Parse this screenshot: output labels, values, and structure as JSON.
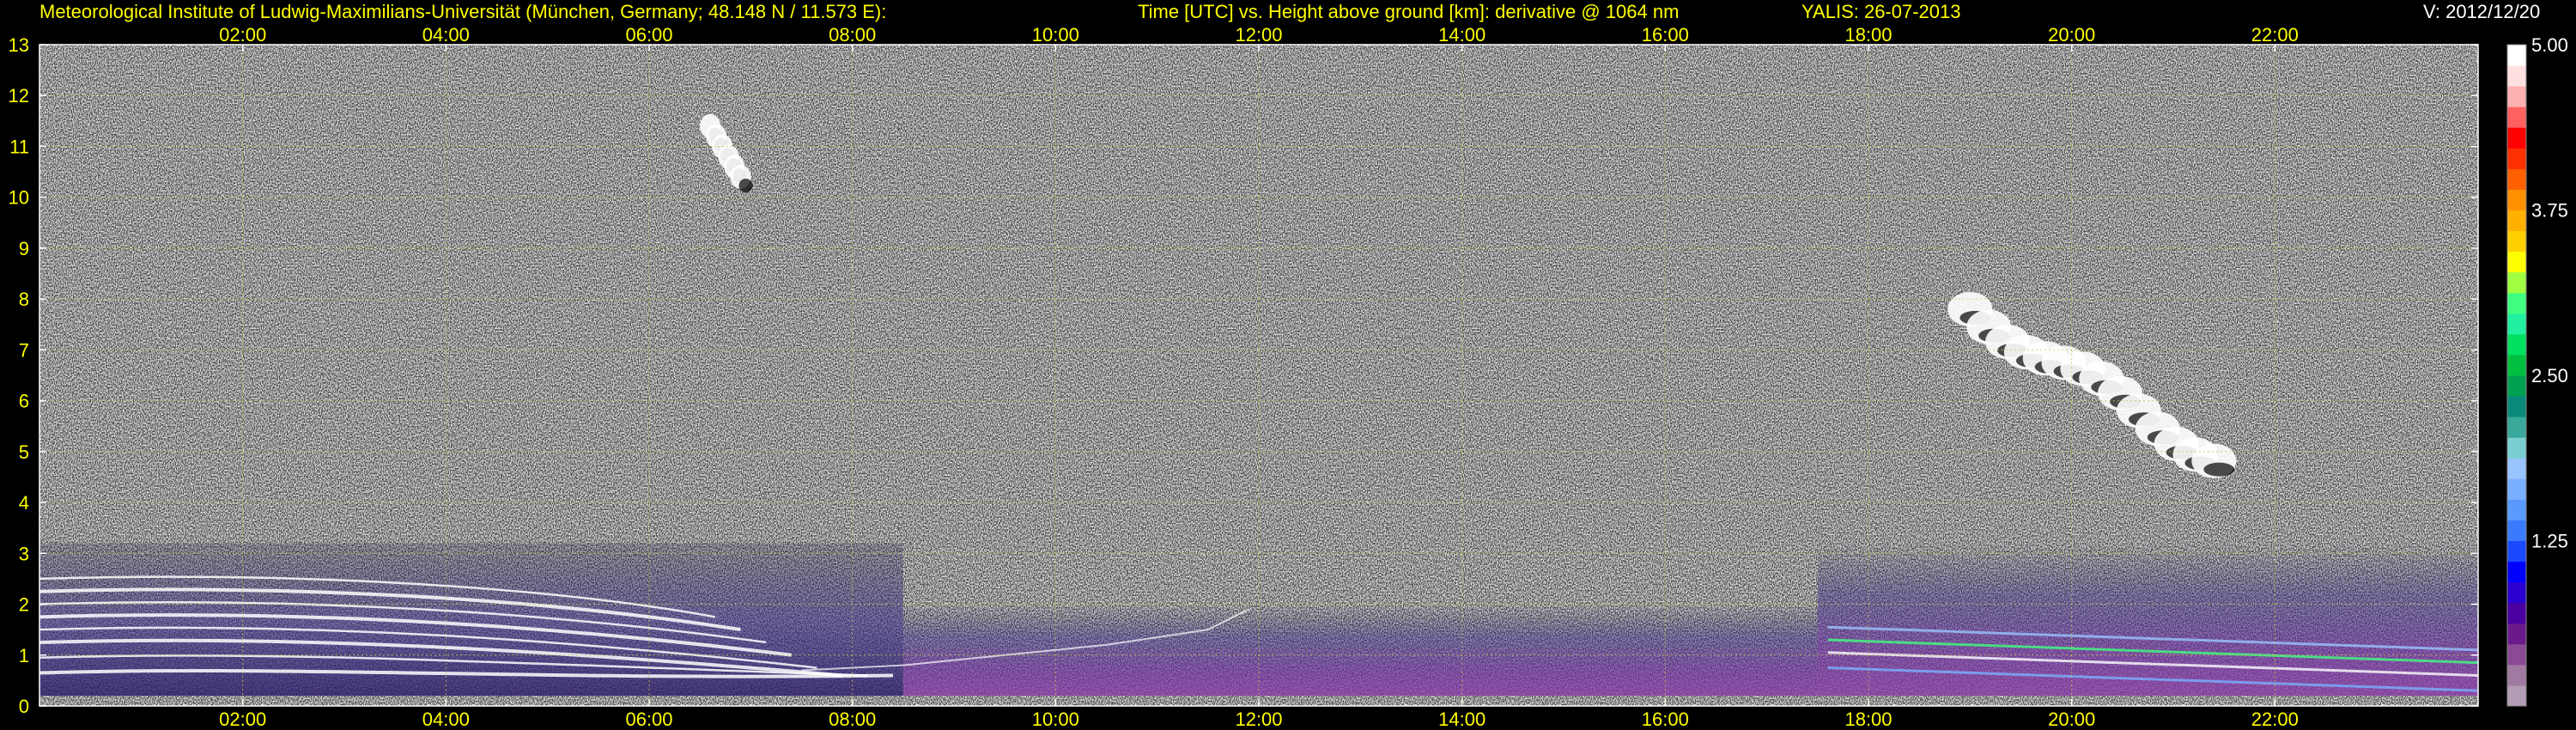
{
  "header": {
    "institute": "Meteorological Institute of Ludwig-Maximilians-Universität (München, Germany; 48.148 N / 11.573 E):",
    "description": "Time [UTC] vs. Height above ground [km]: derivative @ 1064 nm",
    "instrument_date": "YALIS: 26-07-2013",
    "version": "V: 2012/12/20"
  },
  "colors": {
    "background": "#000000",
    "text": "#ffff00",
    "grid": "#c8c84a",
    "frame": "#ffffff"
  },
  "chart_data": {
    "type": "heatmap",
    "title": "Time [UTC] vs. Height above ground [km]: derivative @ 1064 nm",
    "xlabel": "",
    "ylabel": "",
    "x_tick_labels": [
      "02:00",
      "04:00",
      "06:00",
      "08:00",
      "10:00",
      "12:00",
      "14:00",
      "16:00",
      "18:00",
      "20:00",
      "22:00"
    ],
    "x_ticks_hours": [
      2,
      4,
      6,
      8,
      10,
      12,
      14,
      16,
      18,
      20,
      22
    ],
    "xlim_hours": [
      0,
      24
    ],
    "y_ticks": [
      0,
      1,
      2,
      3,
      4,
      5,
      6,
      7,
      8,
      9,
      10,
      11,
      12,
      13
    ],
    "ylim_km": [
      0,
      13
    ],
    "grid": true,
    "colorbar": {
      "labels": [
        "5.00",
        "3.75",
        "2.50",
        "1.25"
      ],
      "label_values": [
        5.0,
        3.75,
        2.5,
        1.25
      ],
      "range": [
        0,
        5.0
      ],
      "colors": [
        "#b49cb4",
        "#a07aa0",
        "#8a4a94",
        "#6a1a8a",
        "#4a00a0",
        "#2a00d0",
        "#0000ff",
        "#1a4aff",
        "#3a7aff",
        "#5a9aff",
        "#7ab0ff",
        "#9ac4ff",
        "#7ad0d0",
        "#3aa89a",
        "#0a8a7a",
        "#00a050",
        "#00c040",
        "#00e060",
        "#20f0a0",
        "#40ff80",
        "#a0ff40",
        "#ffff00",
        "#ffd000",
        "#ffb000",
        "#ff9000",
        "#ff6000",
        "#ff3000",
        "#ff0000",
        "#ff6060",
        "#ffb0b0",
        "#ffe0e0",
        "#ffffff"
      ]
    },
    "features": {
      "boundary_layer_aerosol_km": [
        0.2,
        3.2
      ],
      "cloud_layers_km": [
        {
          "start_hour": 6.6,
          "end_hour": 6.9,
          "base_km": 10.4,
          "top_km": 11.4
        },
        {
          "start_hour": 19.0,
          "end_hour": 21.4,
          "base_km": 4.9,
          "top_km": 7.8
        }
      ]
    }
  }
}
